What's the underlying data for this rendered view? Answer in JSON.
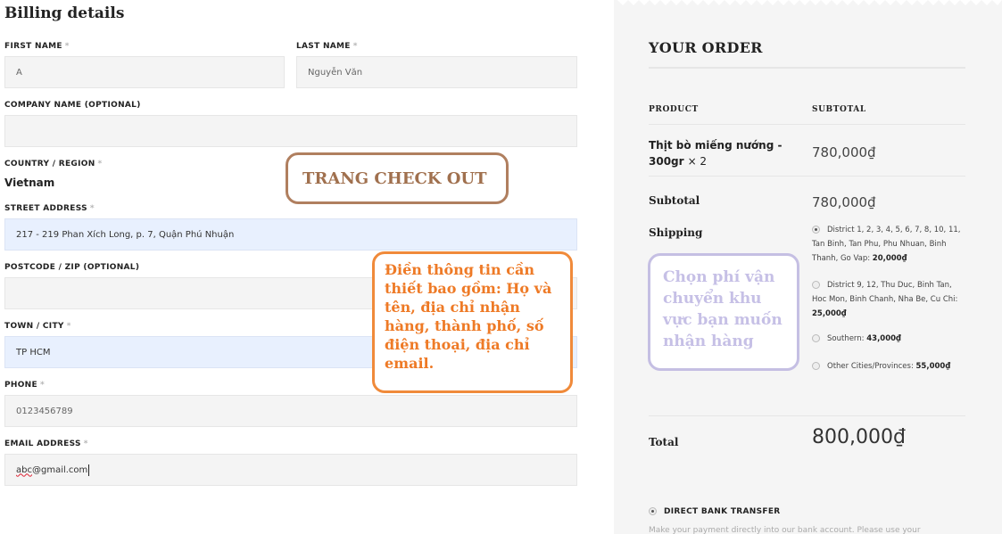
{
  "billing": {
    "title": "Billing details",
    "first_name": {
      "label": "FIRST NAME",
      "required": "*",
      "value": "A"
    },
    "last_name": {
      "label": "LAST NAME",
      "required": "*",
      "value": "Nguyễn Văn"
    },
    "company": {
      "label": "COMPANY NAME (OPTIONAL)",
      "value": ""
    },
    "country": {
      "label": "COUNTRY / REGION",
      "required": "*",
      "value": "Vietnam"
    },
    "street": {
      "label": "STREET ADDRESS",
      "required": "*",
      "value": "217 - 219 Phan Xích Long, p. 7, Quận Phú Nhuận"
    },
    "postcode": {
      "label": "POSTCODE / ZIP (OPTIONAL)",
      "value": ""
    },
    "city": {
      "label": "TOWN / CITY",
      "required": "*",
      "value": "TP HCM"
    },
    "phone": {
      "label": "PHONE",
      "required": "*",
      "value": "0123456789"
    },
    "email": {
      "label": "EMAIL ADDRESS",
      "required": "*",
      "user": "abc",
      "domain": "@gmail.com"
    }
  },
  "annotations": {
    "checkout": "TRANG CHECK OUT",
    "info": "Điền thông tin cần thiết bao gồm: Họ và tên, địa chỉ nhận hàng, thành phố, số điện thoại, địa chỉ email.",
    "shipping": "Chọn phí vận chuyển khu vực bạn muốn nhận hàng"
  },
  "order": {
    "title": "YOUR ORDER",
    "col_product": "PRODUCT",
    "col_subtotal": "SUBTOTAL",
    "product_name": "Thịt bò miếng nướng - 300gr",
    "product_qty": "× 2",
    "product_subtotal": "780,000₫",
    "subtotal_label": "Subtotal",
    "subtotal_value": "780,000₫",
    "shipping_label": "Shipping",
    "shipping_options": [
      {
        "text": "District 1, 2, 3, 4, 5, 6, 7, 8, 10, 11, Tan Binh, Tan Phu, Phu Nhuan, Binh Thanh, Go Vap:",
        "price": "20,000₫",
        "selected": true
      },
      {
        "text": "District 9, 12, Thu Duc, Binh Tan, Hoc Mon, Binh Chanh, Nha Be, Cu Chi:",
        "price": "25,000₫",
        "selected": false
      },
      {
        "text": "Southern:",
        "price": "43,000₫",
        "selected": false
      },
      {
        "text": "Other Cities/Provinces:",
        "price": "55,000₫",
        "selected": false
      }
    ],
    "total_label": "Total",
    "total_value": "800,000₫",
    "payment_option": "DIRECT BANK TRANSFER",
    "payment_desc": "Make your payment directly into our bank account. Please use your"
  },
  "colors": {
    "panel_bg": "#f5f5f5",
    "autofill_bg": "#e8f0fe",
    "checkout_border": "#b07f5f",
    "info_orange": "#ee7a26",
    "shipping_lavender": "#c5bfe3"
  }
}
